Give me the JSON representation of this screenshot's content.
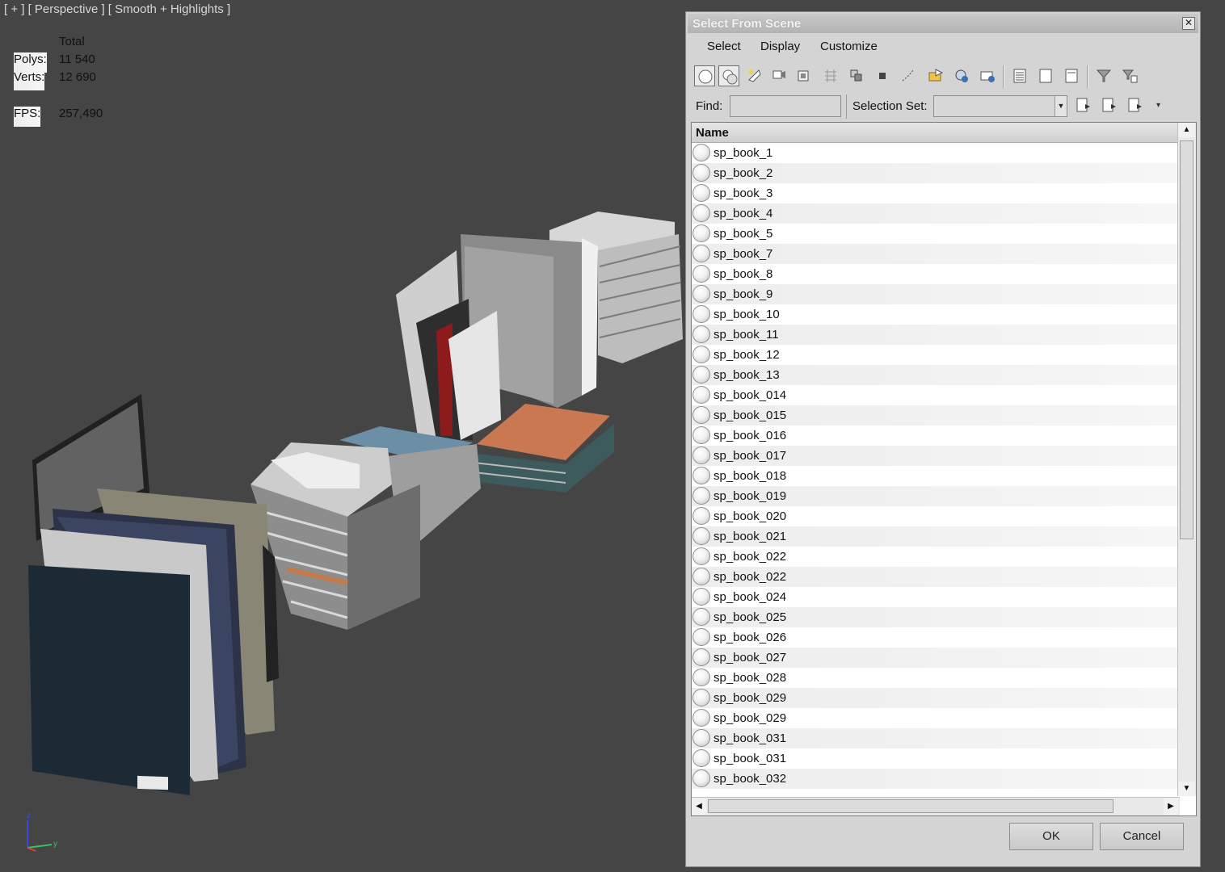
{
  "viewport": {
    "label": "[ + ] [ Perspective ] [ Smooth + Highlights ]",
    "stats": {
      "total_label": "Total",
      "polys_label": "Polys:",
      "polys_value": "11 540",
      "verts_label": "Verts:",
      "verts_value": "12 690",
      "fps_label": "FPS:",
      "fps_value": "257,490"
    },
    "axis": {
      "z": "z",
      "y": "y",
      "x": "x"
    }
  },
  "dialog": {
    "title": "Select From Scene",
    "close_label": "✕",
    "menu": [
      "Select",
      "Display",
      "Customize"
    ],
    "find_label": "Find:",
    "find_value": "",
    "selection_set_label": "Selection Set:",
    "selection_set_value": "",
    "list_header": "Name",
    "items": [
      "sp_book_1",
      "sp_book_2",
      "sp_book_3",
      "sp_book_4",
      "sp_book_5",
      "sp_book_7",
      "sp_book_8",
      "sp_book_9",
      "sp_book_10",
      "sp_book_11",
      "sp_book_12",
      "sp_book_13",
      "sp_book_014",
      "sp_book_015",
      "sp_book_016",
      "sp_book_017",
      "sp_book_018",
      "sp_book_019",
      "sp_book_020",
      "sp_book_021",
      "sp_book_022",
      "sp_book_022",
      "sp_book_024",
      "sp_book_025",
      "sp_book_026",
      "sp_book_027",
      "sp_book_028",
      "sp_book_029",
      "sp_book_029",
      "sp_book_031",
      "sp_book_031",
      "sp_book_032"
    ],
    "ok_label": "OK",
    "cancel_label": "Cancel"
  },
  "colors": {
    "viewport_bg": "#454545",
    "stats_text": "#e2cf4a",
    "dialog_bg": "#d4d4d4"
  }
}
